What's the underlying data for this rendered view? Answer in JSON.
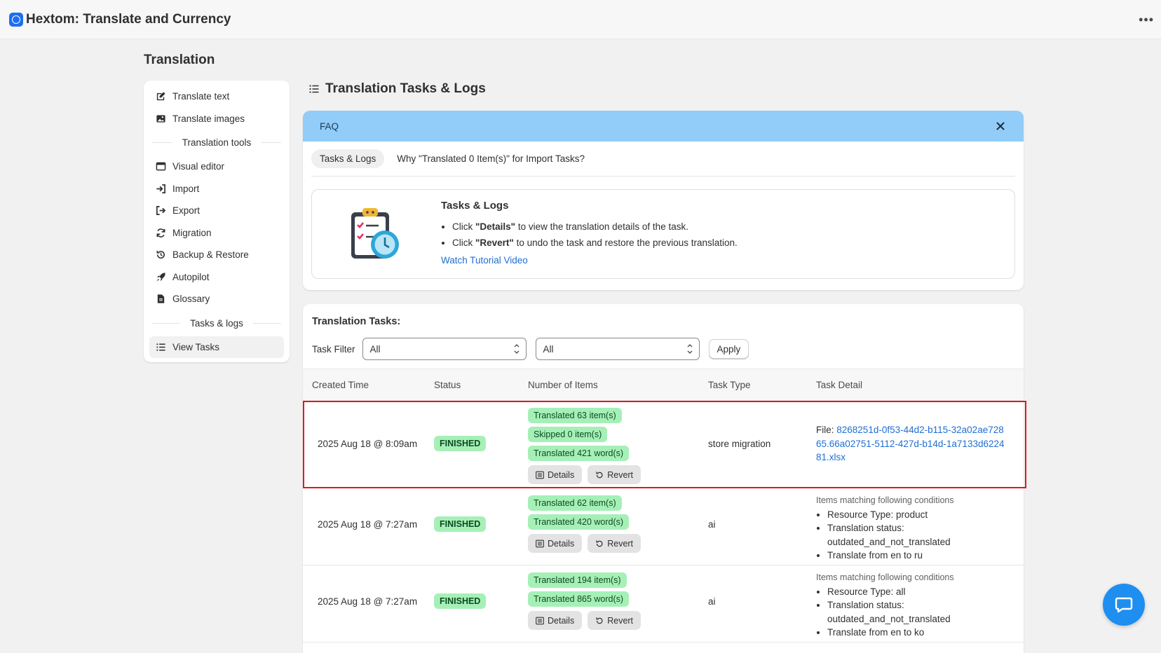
{
  "app": {
    "title": "Hextom: Translate and Currency"
  },
  "page": {
    "title": "Translation"
  },
  "sidebar": {
    "items_top": [
      {
        "label": "Translate text",
        "icon": "edit-icon"
      },
      {
        "label": "Translate images",
        "icon": "image-icon"
      }
    ],
    "section_tools": "Translation tools",
    "items_tools": [
      {
        "label": "Visual editor",
        "icon": "window-icon"
      },
      {
        "label": "Import",
        "icon": "import-icon"
      },
      {
        "label": "Export",
        "icon": "export-icon"
      },
      {
        "label": "Migration",
        "icon": "refresh-icon"
      },
      {
        "label": "Backup & Restore",
        "icon": "history-icon"
      },
      {
        "label": "Autopilot",
        "icon": "rocket-icon"
      },
      {
        "label": "Glossary",
        "icon": "document-icon"
      }
    ],
    "section_logs": "Tasks & logs",
    "items_logs": [
      {
        "label": "View Tasks",
        "icon": "list-icon",
        "active": true
      }
    ]
  },
  "main": {
    "title": "Translation Tasks & Logs"
  },
  "faq": {
    "header": "FAQ",
    "tabs": [
      "Tasks & Logs",
      "Why \"Translated 0 Item(s)\" for Import Tasks?"
    ],
    "box_title": "Tasks & Logs",
    "bullets": [
      {
        "pre": "Click ",
        "bold": "\"Details\"",
        "post": " to view the translation details of the task."
      },
      {
        "pre": "Click ",
        "bold": "\"Revert\"",
        "post": " to undo the task and restore the previous translation."
      }
    ],
    "link": "Watch Tutorial Video"
  },
  "tasks": {
    "title": "Translation Tasks:",
    "filter_label": "Task Filter",
    "filter1": "All",
    "filter2": "All",
    "apply": "Apply",
    "columns": [
      "Created Time",
      "Status",
      "Number of Items",
      "Task Type",
      "Task Detail"
    ],
    "details_label": "Details",
    "revert_label": "Revert",
    "rows": [
      {
        "created": "2025 Aug 18 @ 8:09am",
        "status": "FINISHED",
        "pills": [
          "Translated 63 item(s)",
          "Skipped 0 item(s)",
          "Translated 421 word(s)"
        ],
        "type": "store migration",
        "file_prefix": "File: ",
        "file_name": "8268251d-0f53-44d2-b115-32a02ae72865.66a02751-5112-427d-b14d-1a7133d622481.xlsx"
      },
      {
        "created": "2025 Aug 18 @ 7:27am",
        "status": "FINISHED",
        "pills": [
          "Translated 62 item(s)",
          "Translated 420 word(s)"
        ],
        "type": "ai",
        "cond_head": "Items matching following conditions",
        "conds": [
          "Resource Type: product",
          "Translation status: outdated_and_not_translated",
          "Translate from en to ru"
        ]
      },
      {
        "created": "2025 Aug 18 @ 7:27am",
        "status": "FINISHED",
        "pills": [
          "Translated 194 item(s)",
          "Translated 865 word(s)"
        ],
        "type": "ai",
        "cond_head": "Items matching following conditions",
        "conds": [
          "Resource Type: all",
          "Translation status: outdated_and_not_translated",
          "Translate from en to ko"
        ]
      }
    ]
  },
  "colors": {
    "accent": "#1f6ed4",
    "faq_header": "#91cdf8",
    "badge": "#a6f0b8",
    "highlight": "#e1191e"
  }
}
